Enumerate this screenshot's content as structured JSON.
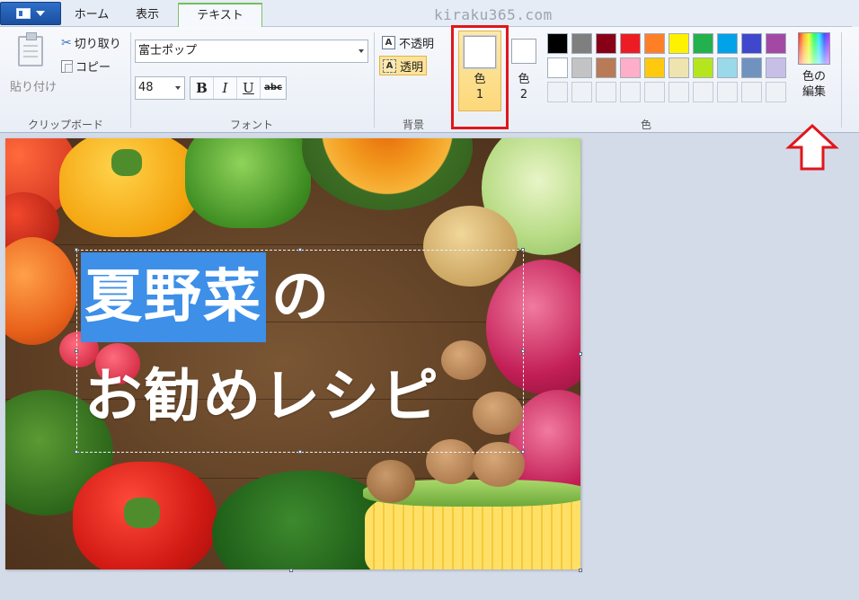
{
  "tabs": {
    "home": "ホーム",
    "view": "表示",
    "text": "テキスト"
  },
  "watermark": "kiraku365.com",
  "clipboard": {
    "paste": "貼り付け",
    "cut": "切り取り",
    "copy": "コピー",
    "group_label": "クリップボード"
  },
  "font": {
    "name": "富士ポップ",
    "size": "48",
    "bold": "B",
    "italic": "I",
    "underline": "U",
    "strikethrough": "abc",
    "group_label": "フォント"
  },
  "background": {
    "opaque": "不透明",
    "transparent": "透明",
    "icon_letter": "A",
    "group_label": "背景"
  },
  "colors": {
    "color1_label_a": "色",
    "color1_label_b": "1",
    "color2_label_a": "色",
    "color2_label_b": "2",
    "edit_label_a": "色の",
    "edit_label_b": "編集",
    "group_label": "色",
    "color1_value": "#ffffff",
    "color2_value": "#ffffff",
    "palette": [
      "#000000",
      "#7f7f7f",
      "#880015",
      "#ed1c24",
      "#ff7f27",
      "#fff200",
      "#22b14c",
      "#00a2e8",
      "#3f48cc",
      "#a349a4",
      "#ffffff",
      "#c3c3c3",
      "#b97a57",
      "#ffaec9",
      "#ffc90e",
      "#efe4b0",
      "#b5e61d",
      "#99d9ea",
      "#7092be",
      "#c8bfe7",
      "",
      "",
      "",
      "",
      "",
      "",
      "",
      "",
      "",
      ""
    ]
  },
  "annotation": {
    "highlight_color": "#e0161c"
  },
  "canvas": {
    "line1_highlighted": "夏野菜",
    "line1_rest": "の",
    "line2": "お勧めレシピ"
  }
}
